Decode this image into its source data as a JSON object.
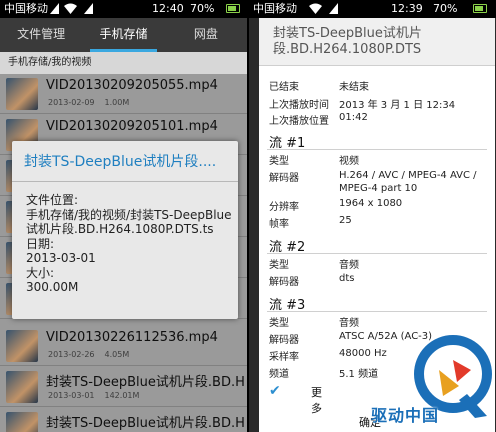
{
  "left": {
    "status": {
      "carrier": "中国移动",
      "time": "12:40",
      "battery": "70%"
    },
    "tabs": [
      "文件管理",
      "手机存储",
      "网盘"
    ],
    "breadcrumb": "手机存储/我的视频",
    "files": [
      {
        "name": "VID20130209205055.mp4",
        "date": "2013-02-09",
        "size": "1.00M"
      },
      {
        "name": "VID20130209205101.mp4",
        "date": "",
        "size": ""
      },
      {
        "name": "",
        "date": "",
        "size": ""
      },
      {
        "name": "",
        "date": "",
        "size": ""
      },
      {
        "name": "",
        "date": "",
        "size": ""
      },
      {
        "name": "",
        "date": "",
        "size": ""
      },
      {
        "name": "VID20130226112536.mp4",
        "date": "2013-02-26",
        "size": "4.05M"
      },
      {
        "name": "封装TS-DeepBlue试机片段.BD.H",
        "date": "2013-03-01",
        "size": "142.01M"
      },
      {
        "name": "封装TS-DeepBlue试机片段.BD.H",
        "date": "",
        "size": ""
      }
    ],
    "dialog": {
      "title": "封装TS-DeepBlue试机片段....",
      "location_label": "文件位置:",
      "location_value": "手机存储/我的视频/封装TS-DeepBlue试机片段.BD.H264.1080P.DTS.ts",
      "date_label": "日期:",
      "date_value": "2013-03-01",
      "size_label": "大小:",
      "size_value": "300.00M"
    }
  },
  "right": {
    "status": {
      "carrier": "中国移动",
      "time": "12:39",
      "battery": "70%"
    },
    "title": "封装TS-DeepBlue试机片段.BD.H264.1080P.DTS",
    "rows_top": [
      {
        "k": "已结束",
        "v": "未结束"
      },
      {
        "k": "上次播放时间",
        "v": "2013 年 3 月 1 日 12:34"
      },
      {
        "k": "上次播放位置",
        "v": "01:42"
      }
    ],
    "stream1": {
      "title": "流 #1",
      "rows": [
        {
          "k": "类型",
          "v": "视频"
        },
        {
          "k": "解码器",
          "v": "H.264 / AVC / MPEG-4 AVC / MPEG-4 part 10"
        },
        {
          "k": "分辨率",
          "v": "1964 x 1080"
        },
        {
          "k": "帧率",
          "v": "25"
        }
      ]
    },
    "stream2": {
      "title": "流 #2",
      "rows": [
        {
          "k": "类型",
          "v": "音频"
        },
        {
          "k": "解码器",
          "v": "dts"
        }
      ]
    },
    "stream3": {
      "title": "流 #3",
      "rows": [
        {
          "k": "类型",
          "v": "音频"
        },
        {
          "k": "解码器",
          "v": "ATSC A/52A (AC-3)"
        },
        {
          "k": "采样率",
          "v": "48000 Hz"
        },
        {
          "k": "频道",
          "v": "5.1 频道"
        }
      ]
    },
    "more_label": "更多",
    "confirm_label": "确定"
  },
  "watermark": "驱动中国",
  "colors": {
    "accent": "#3aa8e0",
    "dialog_title": "#1f7fc0",
    "battery": "#8bd24a"
  }
}
